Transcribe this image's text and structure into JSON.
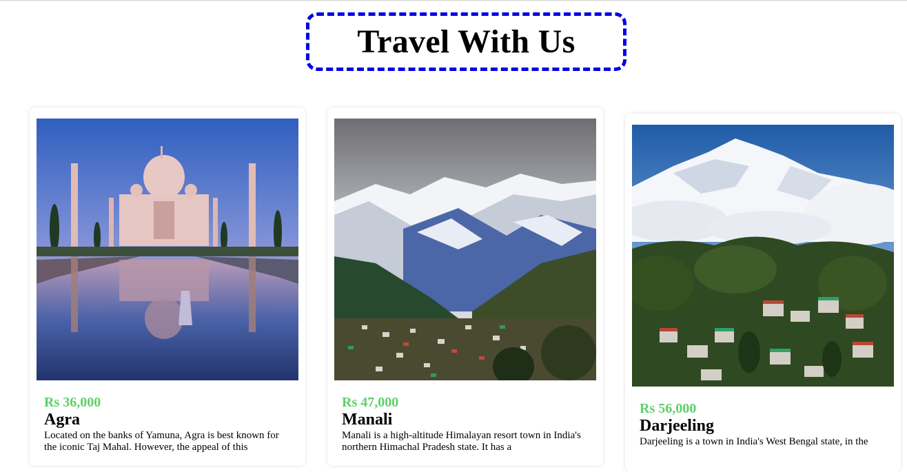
{
  "header": {
    "title": "Travel With Us"
  },
  "cards": [
    {
      "image_name": "taj-mahal-image",
      "price": "Rs 36,000",
      "place": "Agra",
      "description": "Located on the banks of Yamuna, Agra is best known for the iconic Taj Mahal. However, the appeal of this"
    },
    {
      "image_name": "manali-mountains-image",
      "price": "Rs 47,000",
      "place": "Manali",
      "description": "Manali is a high-altitude Himalayan resort town in India's northern Himachal Pradesh state. It has a"
    },
    {
      "image_name": "darjeeling-mountains-image",
      "price": "Rs 56,000",
      "place": "Darjeeling",
      "description": "Darjeeling is a town in India's West Bengal state, in the"
    }
  ],
  "colors": {
    "title_border": "#0000e6",
    "price": "#5fd068"
  }
}
